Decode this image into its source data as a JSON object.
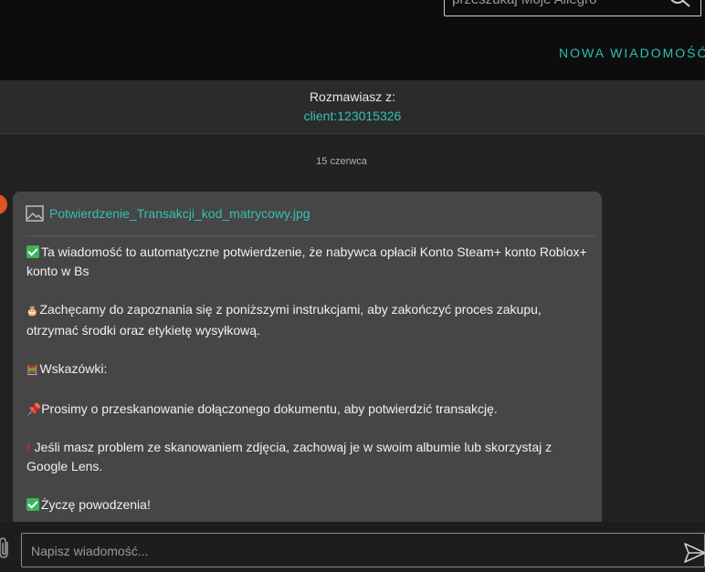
{
  "header": {
    "search_placeholder": "przeszukaj Moje Allegro",
    "search_icon": "search-icon",
    "new_message_label": "NOWA WIADOMOŚĆ"
  },
  "conversation": {
    "talking_with_label": "Rozmawiasz z:",
    "client_name": "client:123015326"
  },
  "messages": {
    "date_label": "15 czerwca",
    "attachment": {
      "icon": "image-icon",
      "filename": "Potwierdzenie_Transakcji_kod_matrycowy.jpg"
    },
    "body": {
      "p1": "Ta wiadomość to automatyczne potwierdzenie, że nabywca opłacił Konto Steam+ konto Roblox+ konto w Bs",
      "p2": "Zachęcamy do zapoznania się z poniższymi instrukcjami, aby zakończyć proces zakupu, otrzymać środki oraz etykietę wysyłkową.",
      "p3": "Wskazówki:",
      "p4": "Prosimy o przeskanowanie dołączonego dokumentu, aby potwierdzić transakcję.",
      "p5": "Jeśli masz problem ze skanowaniem zdjęcia, zachowaj je w swoim albumie lub skorzystaj z Google Lens.",
      "p6": "Życzę powodzenia!"
    },
    "icons": [
      "check-emoji-icon",
      "cake-emoji-icon",
      "abacus-emoji-icon",
      "pushpin-emoji-icon",
      "exclamation-emoji-icon"
    ]
  },
  "composer": {
    "placeholder": "Napisz wiadomość...",
    "attach_icon": "paperclip-icon",
    "send_icon": "send-icon"
  },
  "colors": {
    "accent": "#35c2b0",
    "header_bg": "#0d0d0d",
    "bubble_bg": "#464646",
    "page_bg": "#222222"
  }
}
